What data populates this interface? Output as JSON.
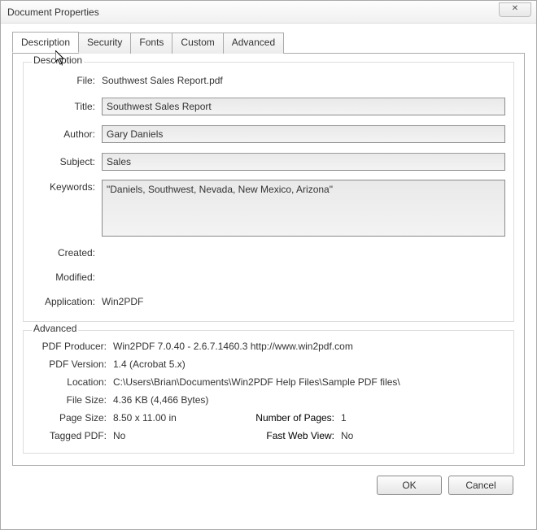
{
  "window": {
    "title": "Document Properties"
  },
  "tabs": {
    "description": "Description",
    "security": "Security",
    "fonts": "Fonts",
    "custom": "Custom",
    "advanced": "Advanced"
  },
  "description": {
    "group_label": "Description",
    "file_label": "File:",
    "file_value": "Southwest Sales Report.pdf",
    "title_label": "Title:",
    "title_value": "Southwest Sales Report",
    "author_label": "Author:",
    "author_value": "Gary Daniels",
    "subject_label": "Subject:",
    "subject_value": "Sales",
    "keywords_label": "Keywords:",
    "keywords_value": "\"Daniels, Southwest, Nevada, New Mexico, Arizona\"",
    "created_label": "Created:",
    "created_value": "",
    "modified_label": "Modified:",
    "modified_value": "",
    "application_label": "Application:",
    "application_value": "Win2PDF"
  },
  "advanced": {
    "group_label": "Advanced",
    "producer_label": "PDF Producer:",
    "producer_value": "Win2PDF 7.0.40 - 2.6.7.1460.3 http://www.win2pdf.com",
    "version_label": "PDF Version:",
    "version_value": "1.4 (Acrobat 5.x)",
    "location_label": "Location:",
    "location_value": "C:\\Users\\Brian\\Documents\\Win2PDF Help Files\\Sample PDF files\\",
    "filesize_label": "File Size:",
    "filesize_value": "4.36 KB (4,466 Bytes)",
    "pagesize_label": "Page Size:",
    "pagesize_value": "8.50 x 11.00 in",
    "numpages_label": "Number of Pages:",
    "numpages_value": "1",
    "tagged_label": "Tagged PDF:",
    "tagged_value": "No",
    "fastweb_label": "Fast Web View:",
    "fastweb_value": "No"
  },
  "buttons": {
    "ok": "OK",
    "cancel": "Cancel"
  }
}
